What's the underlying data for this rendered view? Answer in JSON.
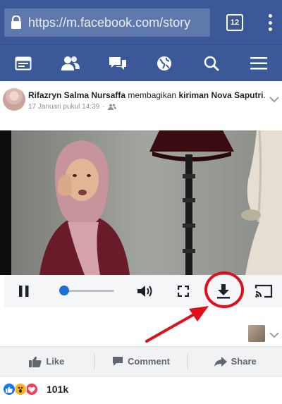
{
  "browser": {
    "url": "https://m.facebook.com/story",
    "tab_count": "12"
  },
  "nav": {
    "items": [
      "news-feed",
      "friends",
      "messages",
      "notifications-globe",
      "search",
      "menu"
    ]
  },
  "post": {
    "author": "Rifazryn Salma Nursaffa",
    "action_text": "membagikan",
    "object_text": "kiriman",
    "original_author": "Nova Saputri",
    "time": "17 Januari pukul 14:39"
  },
  "video": {
    "progress": 0.0
  },
  "actions": {
    "like": "Like",
    "comment": "Comment",
    "share": "Share"
  },
  "reactions": {
    "count": "101k"
  },
  "colors": {
    "brand": "#3b5998",
    "annotation": "#e10e1c",
    "progress": "#1f6fd8"
  }
}
